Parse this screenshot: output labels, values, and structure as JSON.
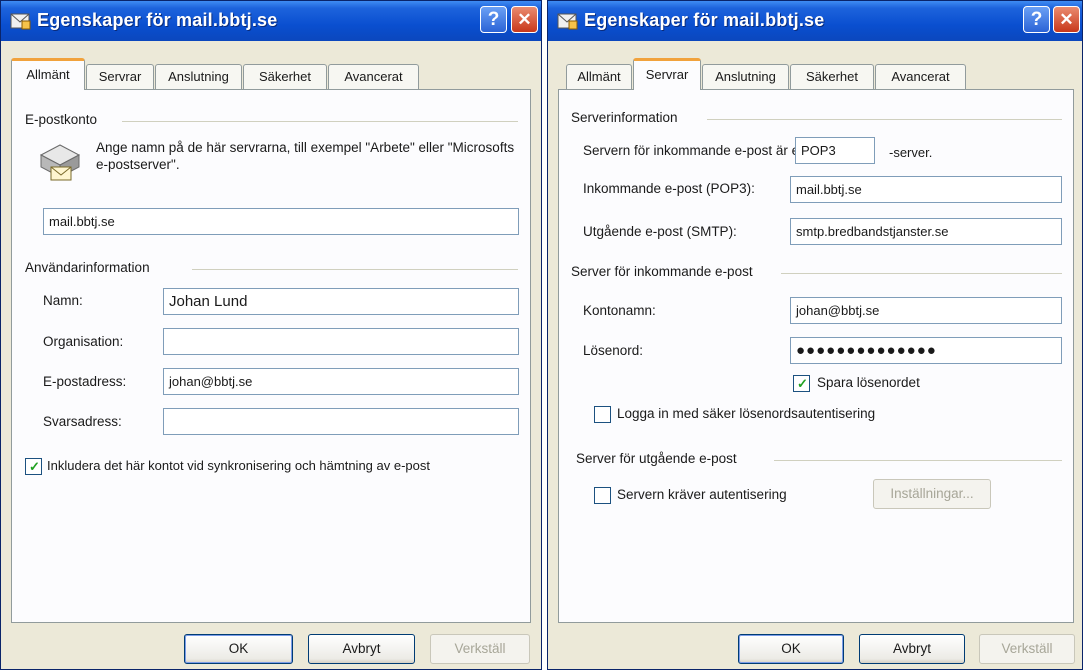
{
  "left": {
    "title": "Egenskaper för mail.bbtj.se",
    "tabs": [
      "Allmänt",
      "Servrar",
      "Anslutning",
      "Säkerhet",
      "Avancerat"
    ],
    "active_tab": "Allmänt",
    "account_group": "E-postkonto",
    "account_hint": "Ange namn på de här servrarna, till exempel \"Arbete\" eller \"Microsofts e-postserver\".",
    "account_name": "mail.bbtj.se",
    "user_group": "Användarinformation",
    "name_label": "Namn:",
    "name_value": "Johan Lund",
    "org_label": "Organisation:",
    "org_value": "",
    "email_label": "E-postadress:",
    "email_value": "johan@bbtj.se",
    "reply_label": "Svarsadress:",
    "reply_value": "",
    "include_label": "Inkludera det här kontot vid synkronisering och hämtning av e-post",
    "include_checked": true,
    "ok_label": "OK",
    "cancel_label": "Avbryt",
    "apply_label": "Verkställ"
  },
  "right": {
    "title": "Egenskaper för mail.bbtj.se",
    "tabs": [
      "Allmänt",
      "Servrar",
      "Anslutning",
      "Säkerhet",
      "Avancerat"
    ],
    "active_tab": "Servrar",
    "server_group": "Serverinformation",
    "incoming_type_prefix": "Servern för inkommande e-post är en",
    "incoming_type": "POP3",
    "incoming_type_suffix": "-server.",
    "incoming_label": "Inkommande e-post (POP3):",
    "incoming_value": "mail.bbtj.se",
    "outgoing_label": "Utgående e-post (SMTP):",
    "outgoing_value": "smtp.bredbandstjanster.se",
    "in_group": "Server för inkommande e-post",
    "account_label": "Kontonamn:",
    "account_value": "johan@bbtj.se",
    "password_label": "Lösenord:",
    "password_value": "●●●●●●●●●●●●●●",
    "save_password_label": "Spara lösenordet",
    "save_password_checked": true,
    "spa_label": "Logga in med säker lösenordsautentisering",
    "spa_checked": false,
    "out_group": "Server för utgående e-post",
    "auth_label": "Servern kräver autentisering",
    "auth_checked": false,
    "settings_label": "Inställningar...",
    "ok_label": "OK",
    "cancel_label": "Avbryt",
    "apply_label": "Verkställ"
  },
  "colors": {
    "titlebar": "#0a4fd0",
    "active_tab_accent": "#f1a23c",
    "check_mark": "#21a121"
  }
}
